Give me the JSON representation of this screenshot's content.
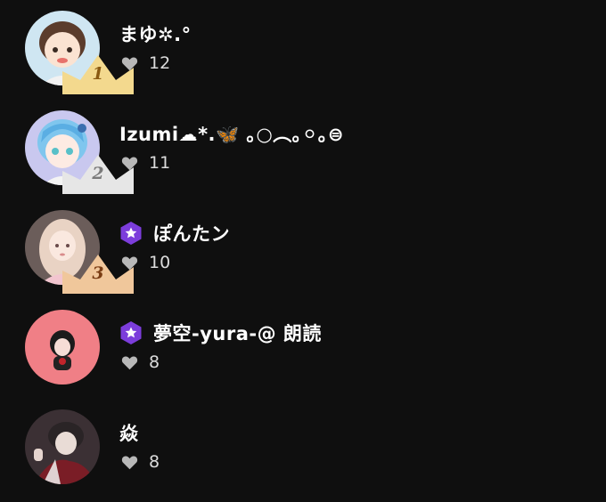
{
  "ranking": [
    {
      "name": "まゆ✲.°",
      "likes": "12",
      "rank_label": "1",
      "crown_color": "#f3d98e",
      "rank_color": "#8a5a12",
      "badge": false,
      "avatar_bg": "#cfe6f2"
    },
    {
      "name": "Izumi☁*.🦋 ｡○︵｡⚪︎｡⊜",
      "likes": "11",
      "rank_label": "2",
      "crown_color": "#e6e6e6",
      "rank_color": "#7a7a7a",
      "badge": false,
      "avatar_bg": "#c9c8ef"
    },
    {
      "name": "ぽんたン",
      "likes": "10",
      "rank_label": "3",
      "crown_color": "#f0c79b",
      "rank_color": "#7a3d14",
      "badge": true,
      "avatar_bg": "#6b5d5a"
    },
    {
      "name": "夢空-yura-@ 朗読",
      "likes": "8",
      "rank_label": "",
      "crown_color": "",
      "rank_color": "",
      "badge": true,
      "avatar_bg": "#f07f86"
    },
    {
      "name": "焱",
      "likes": "8",
      "rank_label": "",
      "crown_color": "",
      "rank_color": "",
      "badge": false,
      "avatar_bg": "#3b3034"
    }
  ],
  "icons": {
    "heart": "heart-icon",
    "badge": "star-hexagon-badge-icon",
    "crown": "crown-icon"
  },
  "colors": {
    "background": "#0f0f0f",
    "text": "#ffffff",
    "muted": "#b8b8b8",
    "badge": "#7c3ddb"
  }
}
